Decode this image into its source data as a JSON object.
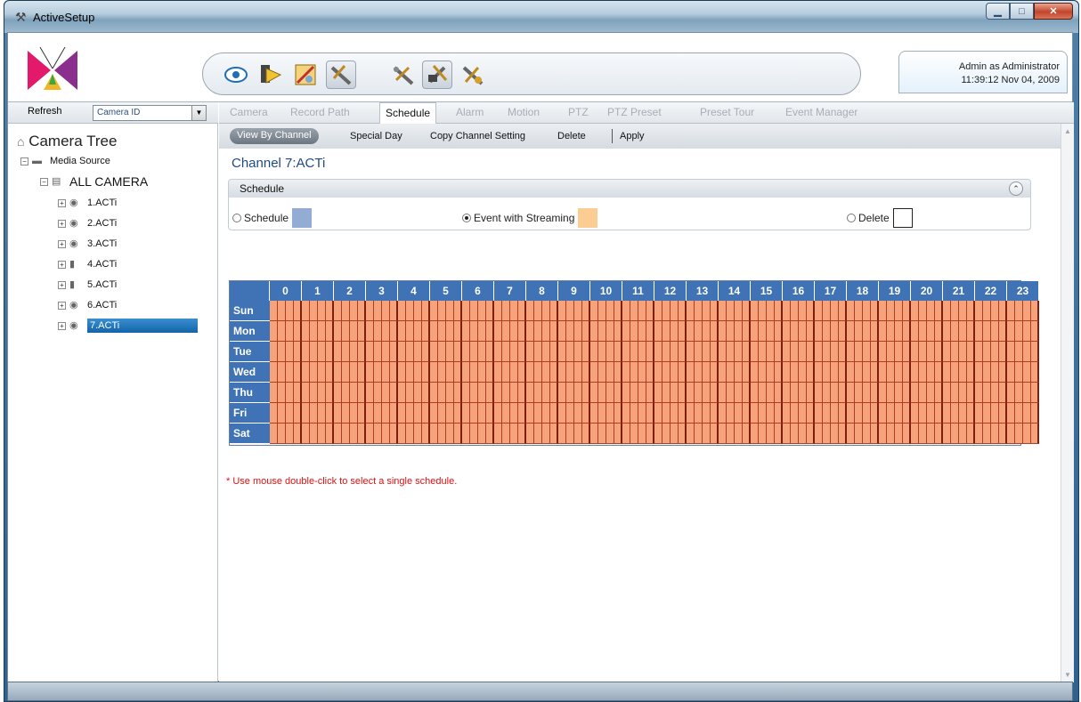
{
  "window": {
    "title": "ActiveSetup",
    "title_icon": "activesetup-icon"
  },
  "header": {
    "user_line": "Admin as Administrator",
    "datetime": "11:39:12 Nov 04, 2009",
    "toolbar_icons": [
      "live-view-icon",
      "playback-icon",
      "record-setup-icon",
      "setup-tools-icon",
      "system-tools-icon",
      "camera-tools-icon",
      "network-tools-icon"
    ]
  },
  "left_panel": {
    "refresh_label": "Refresh",
    "select_value": "Camera ID",
    "tree_title": "Camera Tree",
    "media_source": "Media Source",
    "all_camera": "ALL CAMERA",
    "cameras": [
      "1.ACTi",
      "2.ACTi",
      "3.ACTi",
      "4.ACTi",
      "5.ACTi",
      "6.ACTi",
      "7.ACTi"
    ],
    "selected_camera": "7.ACTi"
  },
  "tabs": [
    "Camera",
    "Record Path",
    "Schedule",
    "Alarm",
    "Motion",
    "PTZ",
    "PTZ Preset",
    "Preset Tour",
    "Event Manager"
  ],
  "active_tab": "Schedule",
  "subtoolbar": [
    "View By Channel",
    "Special Day",
    "Copy Channel Setting",
    "Delete",
    "Apply"
  ],
  "active_subtool": "View By Channel",
  "channel_title": "Channel 7:ACTi",
  "schedule_panel": {
    "header": "Schedule",
    "options": [
      {
        "label": "Schedule",
        "selected": false,
        "color": "#93acd3"
      },
      {
        "label": "Event with Streaming",
        "selected": true,
        "color": "#fbcd92"
      },
      {
        "label": "Delete",
        "selected": false,
        "color": "#ffffff"
      }
    ]
  },
  "grid": {
    "hours": [
      "0",
      "1",
      "2",
      "3",
      "4",
      "5",
      "6",
      "7",
      "8",
      "9",
      "10",
      "11",
      "12",
      "13",
      "14",
      "15",
      "16",
      "17",
      "18",
      "19",
      "20",
      "21",
      "22",
      "23"
    ],
    "days": [
      "Sun",
      "Mon",
      "Tue",
      "Wed",
      "Thu",
      "Fri",
      "Sat"
    ],
    "cell_color": "#f6a27b",
    "header_color": "#3f73b5"
  },
  "note": {
    "star": "*",
    "text": " Use mouse double-click to select a single schedule."
  }
}
